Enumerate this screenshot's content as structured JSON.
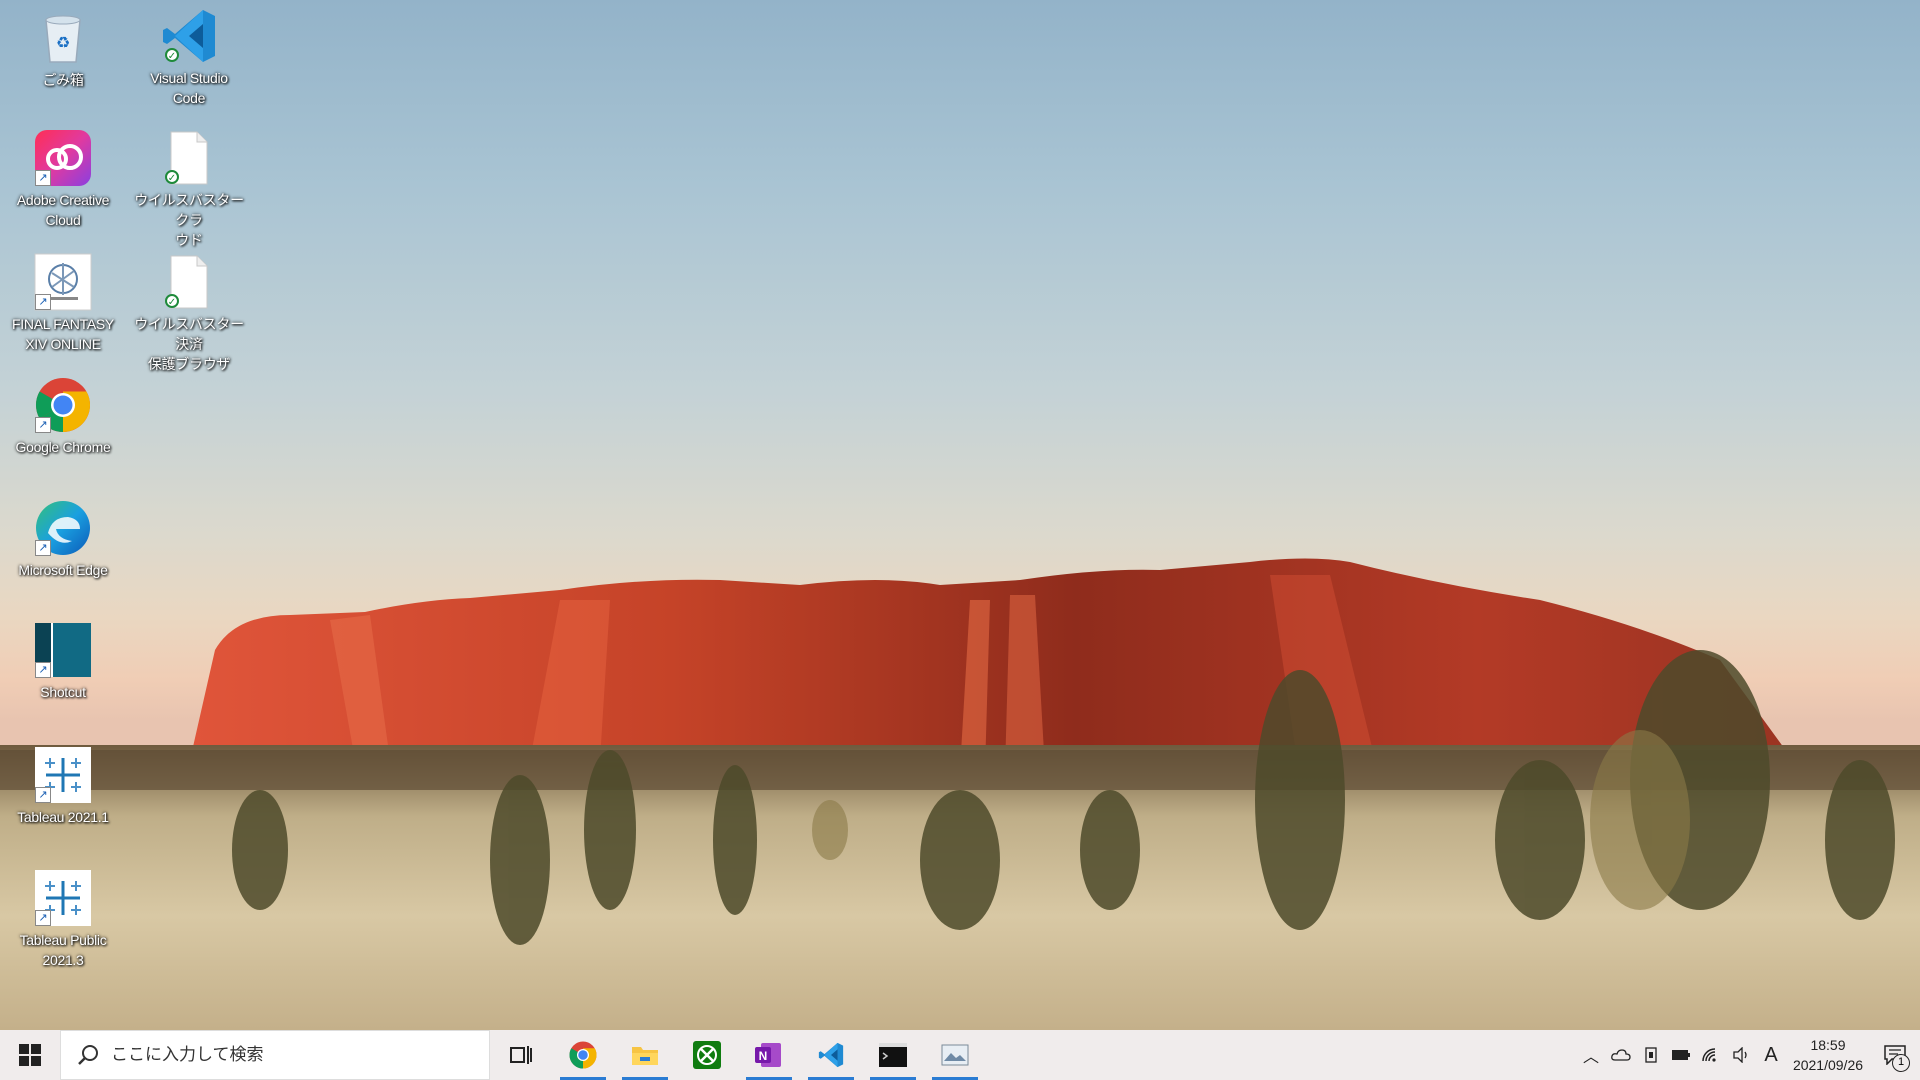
{
  "desktop": {
    "icons": [
      {
        "label": "ごみ箱",
        "icon": "recycle-bin-icon"
      },
      {
        "label": "Visual Studio\nCode",
        "icon": "vscode-icon"
      },
      {
        "label": "Adobe Creative\nCloud",
        "icon": "creative-cloud-icon"
      },
      {
        "label": "ウイルスバスター クラ\nウド",
        "icon": "document-icon"
      },
      {
        "label": "FINAL FANTASY\nXIV ONLINE",
        "icon": "ffxiv-icon"
      },
      {
        "label": "ウイルスバスター 決済\n保護ブラウザ",
        "icon": "document-icon"
      },
      {
        "label": "Google Chrome",
        "icon": "chrome-icon"
      },
      {
        "label": "Microsoft Edge",
        "icon": "edge-icon"
      },
      {
        "label": "Shotcut",
        "icon": "shotcut-icon"
      },
      {
        "label": "Tableau 2021.1",
        "icon": "tableau-icon"
      },
      {
        "label": "Tableau Public\n2021.3",
        "icon": "tableau-icon"
      }
    ]
  },
  "taskbar": {
    "search_placeholder": "ここに入力して検索",
    "apps": [
      {
        "name": "Task View",
        "icon": "task-view-icon",
        "active": false
      },
      {
        "name": "Google Chrome",
        "icon": "chrome-icon",
        "active": true
      },
      {
        "name": "File Explorer",
        "icon": "folder-icon",
        "active": true
      },
      {
        "name": "Xbox",
        "icon": "xbox-icon",
        "active": false
      },
      {
        "name": "OneNote",
        "icon": "onenote-icon",
        "active": true
      },
      {
        "name": "Visual Studio Code",
        "icon": "vscode-icon",
        "active": true
      },
      {
        "name": "Terminal",
        "icon": "terminal-icon",
        "active": true
      },
      {
        "name": "Photos",
        "icon": "photos-icon",
        "active": true
      }
    ],
    "tray": {
      "ime": "A",
      "time": "18:59",
      "date": "2021/09/26",
      "notification_count": "1"
    }
  },
  "colors": {
    "taskbar_bg": "#f0ecec",
    "accent": "#2b7cd3",
    "rock": "#b8402a"
  }
}
